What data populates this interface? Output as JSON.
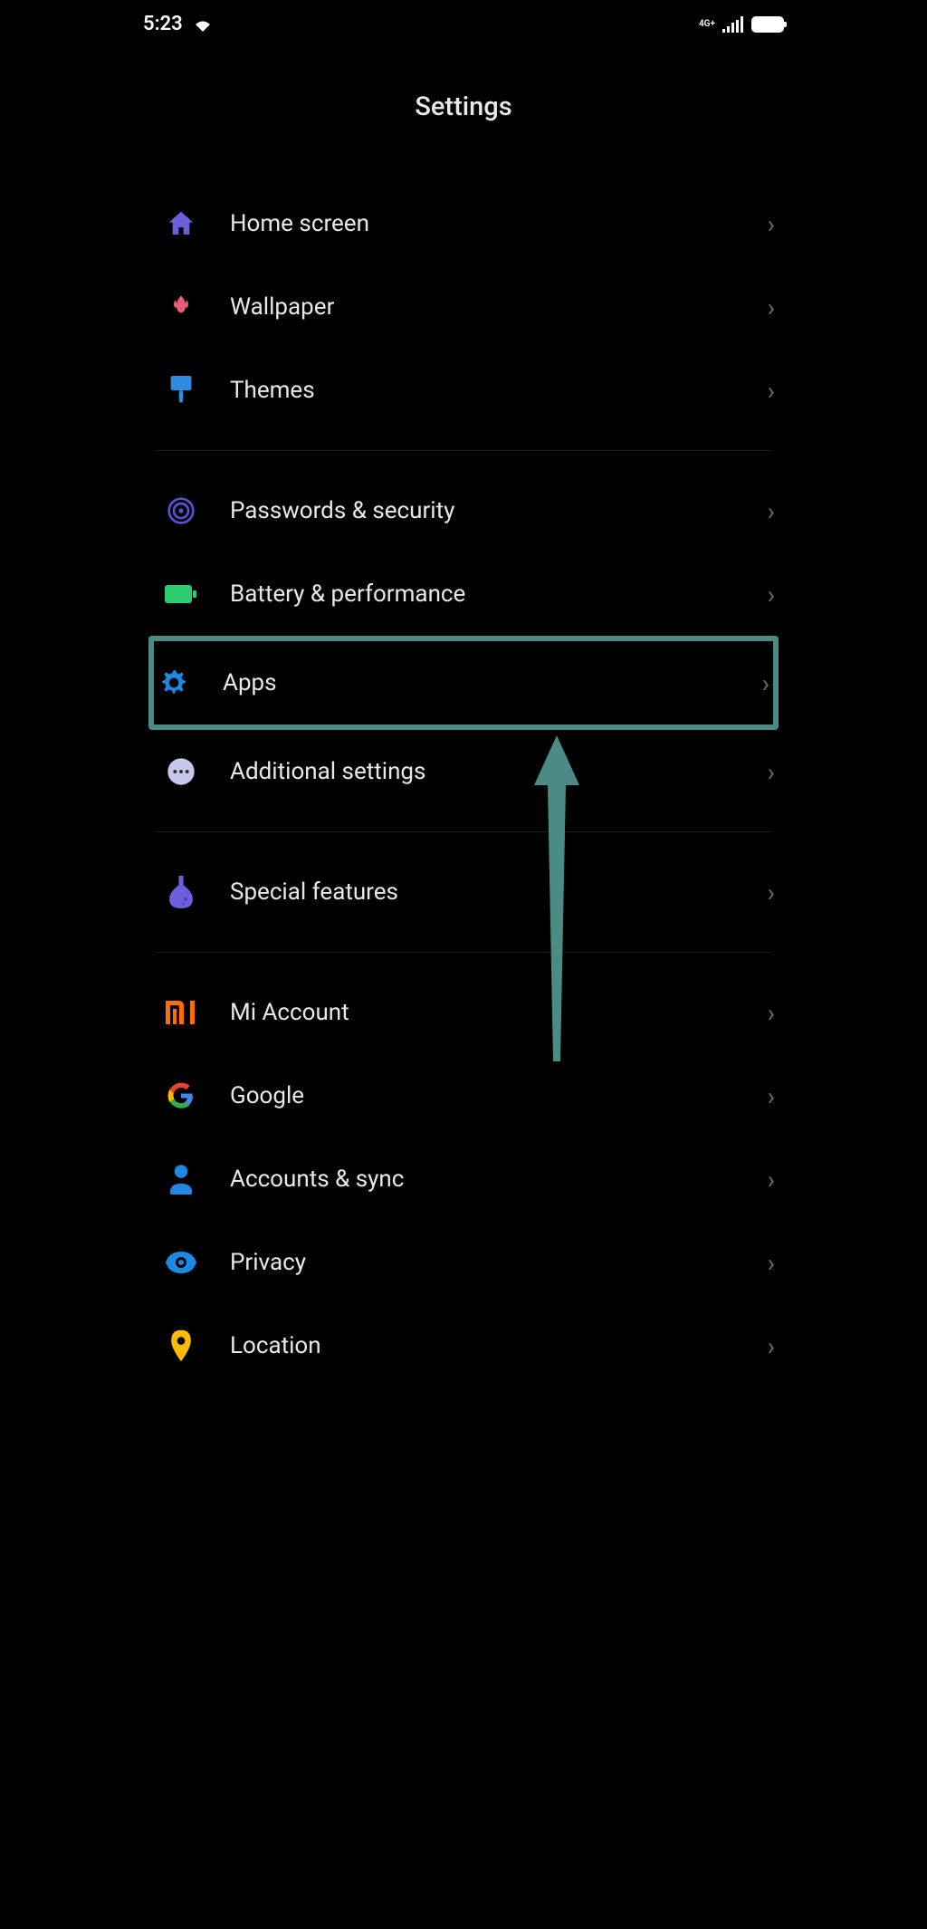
{
  "status_bar": {
    "time": "5:23",
    "network_label": "4G+"
  },
  "header": {
    "title": "Settings"
  },
  "sections": [
    {
      "items": [
        {
          "id": "home-screen",
          "label": "Home screen",
          "icon": "house-icon",
          "color": "#6b5fde"
        },
        {
          "id": "wallpaper",
          "label": "Wallpaper",
          "icon": "tulip-icon",
          "color": "#e85d75"
        },
        {
          "id": "themes",
          "label": "Themes",
          "icon": "paint-icon",
          "color": "#2f8be0"
        }
      ]
    },
    {
      "items": [
        {
          "id": "passwords-security",
          "label": "Passwords & security",
          "icon": "fingerprint-icon",
          "color": "#5a4fcf"
        },
        {
          "id": "battery-performance",
          "label": "Battery & performance",
          "icon": "battery-icon",
          "color": "#2ecc71"
        },
        {
          "id": "apps",
          "label": "Apps",
          "icon": "gear-icon",
          "color": "#1e88e5",
          "highlighted": true
        },
        {
          "id": "additional-settings",
          "label": "Additional settings",
          "icon": "more-icon",
          "color": "#c5c8e8"
        }
      ]
    },
    {
      "items": [
        {
          "id": "special-features",
          "label": "Special features",
          "icon": "flask-icon",
          "color": "#6b5fde"
        }
      ]
    },
    {
      "items": [
        {
          "id": "mi-account",
          "label": "Mi Account",
          "icon": "mi-icon",
          "color": "#ff6f00"
        },
        {
          "id": "google",
          "label": "Google",
          "icon": "google-icon",
          "color": "#4285f4"
        },
        {
          "id": "accounts-sync",
          "label": "Accounts & sync",
          "icon": "person-icon",
          "color": "#1e88e5"
        },
        {
          "id": "privacy",
          "label": "Privacy",
          "icon": "eye-icon",
          "color": "#1e88e5"
        },
        {
          "id": "location",
          "label": "Location",
          "icon": "pin-icon",
          "color": "#fbbc04"
        }
      ]
    }
  ],
  "annotation": {
    "highlight_color": "#4a8b85",
    "arrow_color": "#4a8b85"
  }
}
